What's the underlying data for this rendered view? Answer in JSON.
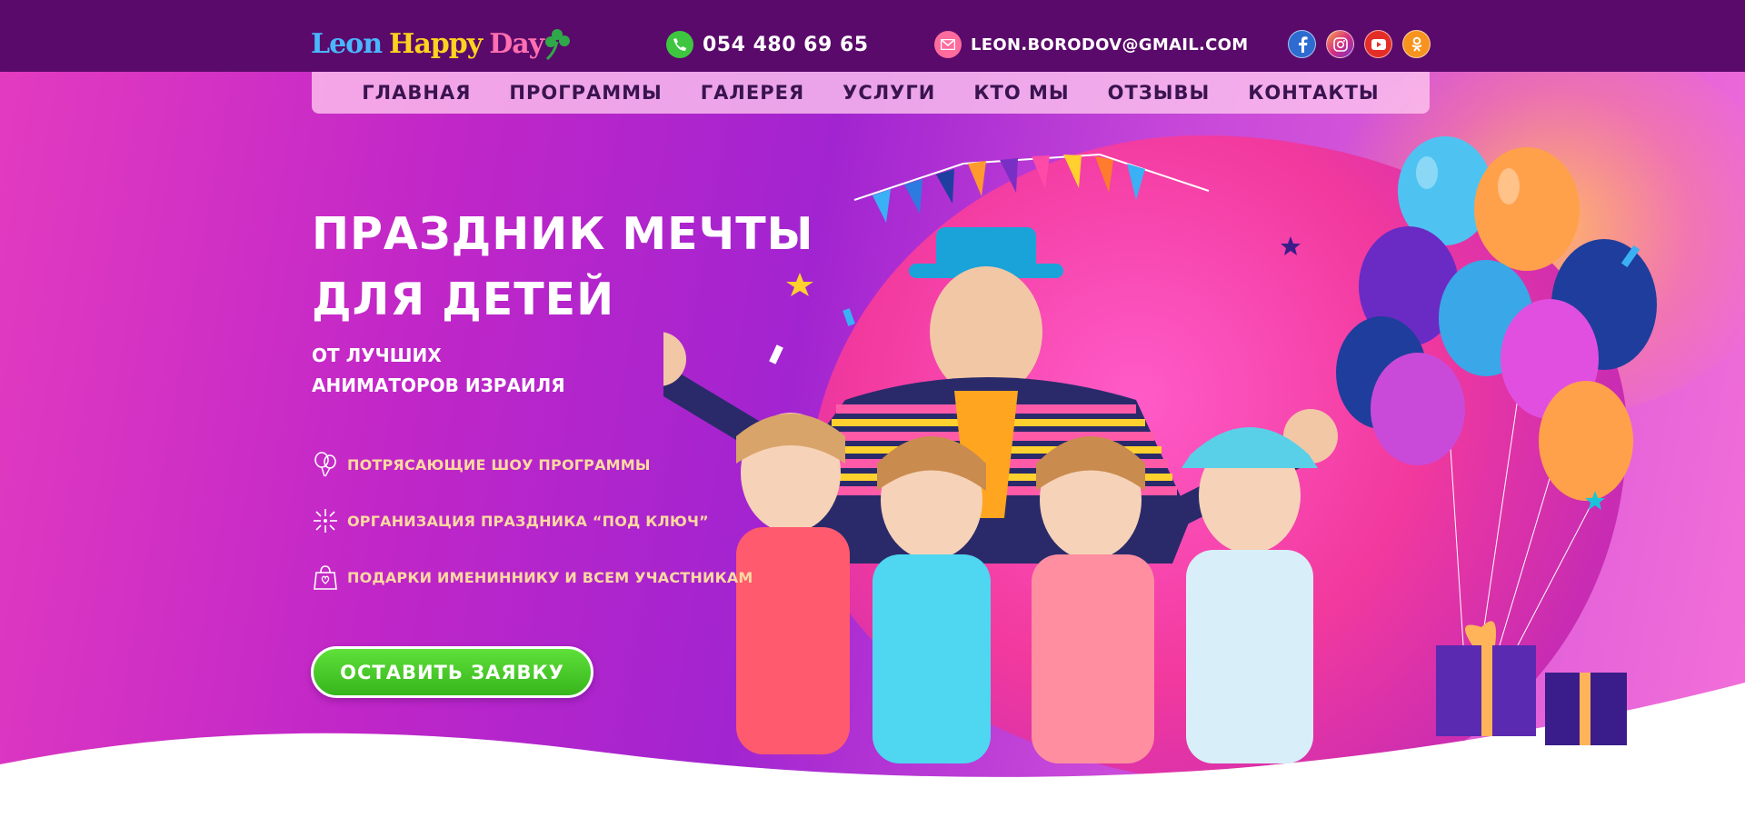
{
  "brand": {
    "logo_parts": [
      "Leon",
      "Happy",
      "Day"
    ]
  },
  "contacts": {
    "phone": "054 480 69 65",
    "email": "LEON.BORODOV@GMAIL.COM"
  },
  "socials": [
    {
      "name": "facebook-icon",
      "glyph": "f"
    },
    {
      "name": "instagram-icon",
      "glyph": "◎"
    },
    {
      "name": "youtube-icon",
      "glyph": "▶"
    },
    {
      "name": "odnoklassniki-icon",
      "glyph": "ok"
    }
  ],
  "nav": {
    "items": [
      "ГЛАВНАЯ",
      "ПРОГРАММЫ",
      "ГАЛЕРЕЯ",
      "УСЛУГИ",
      "КТО МЫ",
      "ОТЗЫВЫ",
      "КОНТАКТЫ"
    ]
  },
  "hero": {
    "title_line1": "ПРАЗДНИК МЕЧТЫ",
    "title_line2": "ДЛЯ ДЕТЕЙ",
    "subtitle_line1": "ОТ ЛУЧШИХ",
    "subtitle_line2": "АНИМАТОРОВ ИЗРАИЛЯ",
    "features": [
      {
        "icon": "balloons-icon",
        "text": "ПОТРЯСАЮЩИЕ ШОУ ПРОГРАММЫ"
      },
      {
        "icon": "firework-icon",
        "text": "ОРГАНИЗАЦИЯ ПРАЗДНИКА “ПОД КЛЮЧ”"
      },
      {
        "icon": "gift-bag-icon",
        "text": "ПОДАРКИ ИМЕНИННИКУ И ВСЕМ УЧАСТНИКАМ"
      }
    ],
    "cta_label": "ОСТАВИТЬ ЗАЯВКУ"
  },
  "colors": {
    "topbar": "#5a0a6a",
    "accent_green": "#3ec640",
    "feature_text": "#ffd9a0"
  }
}
